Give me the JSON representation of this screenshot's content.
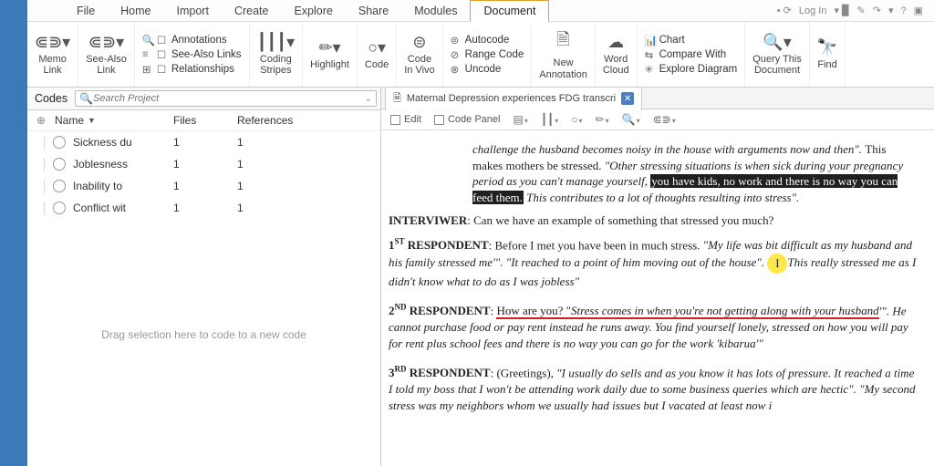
{
  "menu": {
    "items": [
      "File",
      "Home",
      "Import",
      "Create",
      "Explore",
      "Share",
      "Modules",
      "Document"
    ],
    "active": 7,
    "login": "Log In"
  },
  "ribbon": {
    "memo": "Memo\nLink",
    "seealso": "See-Also\nLink",
    "annotations": "Annotations",
    "seealsolinks": "See-Also Links",
    "relationships": "Relationships",
    "coding": "Coding\nStripes",
    "highlight": "Highlight",
    "code": "Code",
    "codevivo": "Code\nIn Vivo",
    "autocode": "Autocode",
    "rangecode": "Range Code",
    "uncode": "Uncode",
    "newannotation": "New\nAnnotation",
    "wordcloud": "Word\nCloud",
    "chart": "Chart",
    "compare": "Compare With",
    "explore": "Explore Diagram",
    "querythis": "Query This\nDocument",
    "find": "Find"
  },
  "panel": {
    "title": "Codes",
    "searchPlaceholder": "Search Project",
    "cols": {
      "name": "Name",
      "files": "Files",
      "refs": "References"
    },
    "rows": [
      {
        "name": "Sickness du",
        "files": "1",
        "refs": "1"
      },
      {
        "name": "Joblesness",
        "files": "1",
        "refs": "1"
      },
      {
        "name": "Inability to",
        "files": "1",
        "refs": "1"
      },
      {
        "name": "Conflict wit",
        "files": "1",
        "refs": "1"
      }
    ],
    "dropHint": "Drag selection here to code to a new code"
  },
  "doc": {
    "tabTitle": "Maternal Depression experiences FDG transcri",
    "toolbar": {
      "edit": "Edit",
      "codepanel": "Code Panel"
    },
    "p1a": "challenge the husband becomes noisy in the house with arguments now and then\". ",
    "p1b": "This makes mothers be stressed. ",
    "p1c": "\"Other stressing situations is when sick during your pregnancy period as you can't manage yourself, ",
    "p1hl": "you have kids, no work and there is no way you can feed them.",
    "p1d": " This contributes to a lot of thoughts resulting into stress\".",
    "intLabel": "INTERVIWER",
    "intText": ": Can we have an example of something that stressed you much?",
    "r1Label": " RESPONDENT",
    "r1Prefix": "1",
    "r1Sup": "ST",
    "r1a": ": Before I met you have been in much stress. ",
    "r1b": "\"My life was bit difficult as my husband and his family stressed me'\". \"It reached to a point of him moving out of the house\". \"This really stressed me as I didn't know what to do as I was jobless\"",
    "r2Prefix": "2",
    "r2Sup": "ND",
    "r2a": "How are you? \"",
    "r2red": "Stress comes in when you're not getting along with your husband",
    "r2b": "'\". He cannot purchase food or pay rent instead he runs away. You find yourself lonely, stressed on how you will pay for rent plus school fees and there is no way you can go for the work 'kibarua'\"",
    "r3Prefix": "3",
    "r3Sup": "RD",
    "r3a": ": (Greetings), ",
    "r3b": "\"I usually do sells and as you know it has lots of pressure. It reached a time I told my boss that I won't be attending work daily due to some business queries which are hectic\". \"My second stress was my neighbors whom we usually had issues but I vacated at least now i"
  }
}
